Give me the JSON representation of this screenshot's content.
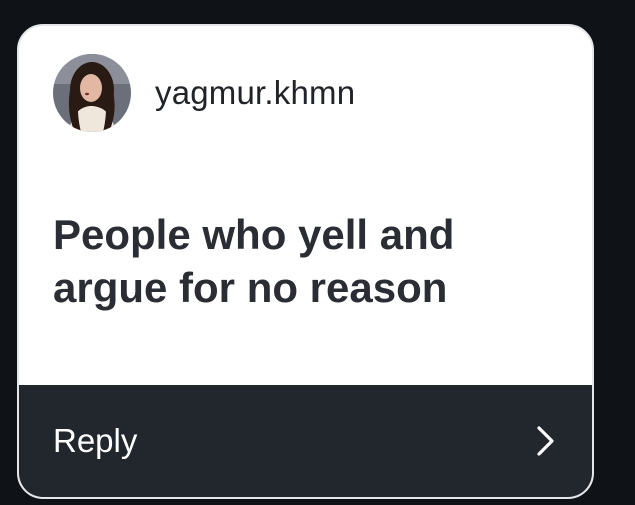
{
  "card": {
    "username": "yagmur.khmn",
    "question": "People who yell and argue for no reason",
    "reply_label": "Reply"
  },
  "icons": {
    "avatar": "profile-photo",
    "reply_action": "chevron-right-icon"
  },
  "colors": {
    "background": "#0f1318",
    "card": "#ffffff",
    "reply_bar": "#22262d",
    "text_dark": "#2a2d33",
    "text_light": "#ffffff"
  }
}
